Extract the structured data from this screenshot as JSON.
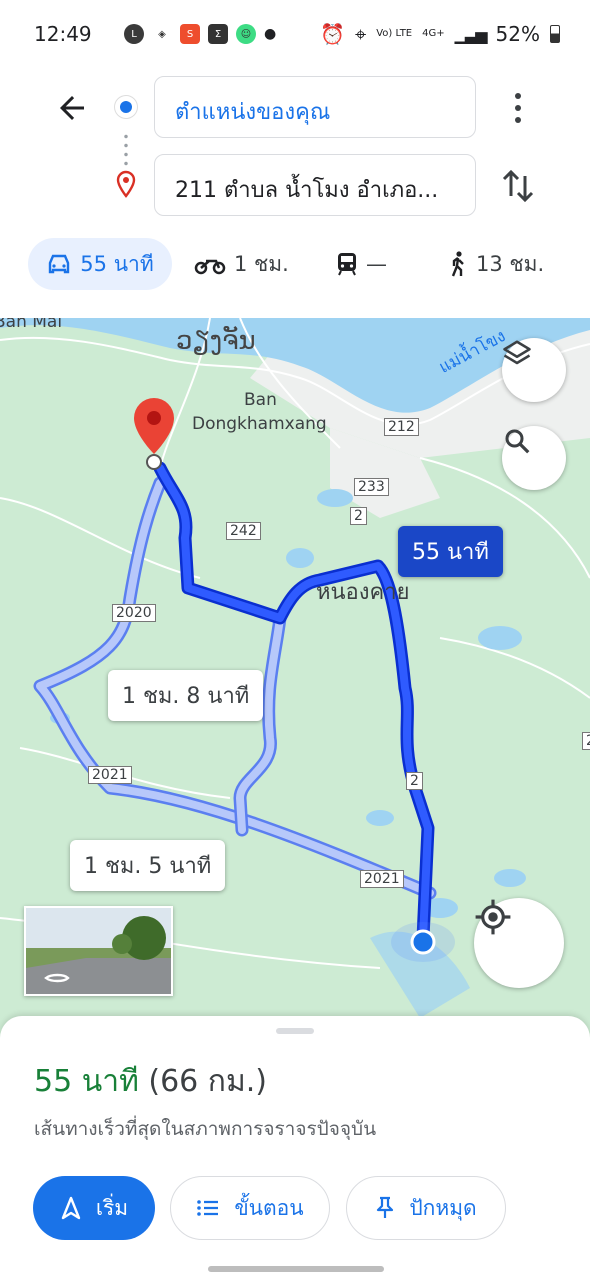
{
  "status_bar": {
    "time": "12:49",
    "battery": "52%",
    "network_lte": "Vo) LTE",
    "network_4g": "4G+",
    "icons": [
      "line-icon",
      "location-arrow-icon",
      "shopee-icon",
      "sigma-icon",
      "android-icon",
      "dot-icon",
      "alarm-icon",
      "location-icon",
      "signal-icon",
      "battery-icon"
    ]
  },
  "directions": {
    "origin": "ตำแหน่งของคุณ",
    "destination": "211 ตำบล น้ำโมง อำเภอ...",
    "colors": {
      "accent": "#1a73e8",
      "destination_pin": "#d93025"
    }
  },
  "modes": [
    {
      "name": "drive",
      "label": "55 นาที",
      "icon": "car-icon",
      "active": true
    },
    {
      "name": "motorcycle",
      "label": "1 ชม.",
      "icon": "motorcycle-icon",
      "active": false
    },
    {
      "name": "transit",
      "label": "—",
      "icon": "train-icon",
      "active": false
    },
    {
      "name": "walk",
      "label": "13 ชม.",
      "icon": "walk-icon",
      "active": false
    }
  ],
  "map": {
    "labels": {
      "ban_mai": "Ban Mai",
      "vientiane": "ວຽງຈັນ",
      "ban_dongkhamxang_1": "Ban",
      "ban_dongkhamxang_2": "Dongkhamxang",
      "nong_khai": "หนองคาย",
      "mekong": "แม่น้ำโขง"
    },
    "road_shields": [
      "212",
      "233",
      "2",
      "242",
      "2020",
      "2",
      "2021",
      "2021",
      "2"
    ],
    "routes": [
      {
        "label": "55 นาที",
        "selected": true
      },
      {
        "label": "1 ชม. 8 นาที",
        "selected": false
      },
      {
        "label": "1 ชม. 5 นาที",
        "selected": false
      }
    ],
    "buttons": {
      "layers": "layers-icon",
      "search": "search-icon",
      "my_location": "my-location-icon",
      "street_view": "street-view-icon"
    },
    "colors": {
      "land": "#cdebd3",
      "water": "#9fd3f2",
      "route_selected": "#1a47ff",
      "route_alt": "#9db4f5"
    }
  },
  "sheet": {
    "duration": "55 นาที",
    "distance": "(66 กม.)",
    "description": "เส้นทางเร็วที่สุดในสภาพการจราจรปัจจุบัน",
    "buttons": {
      "start": "เริ่ม",
      "steps": "ขั้นตอน",
      "pin": "ปักหมุด"
    }
  }
}
